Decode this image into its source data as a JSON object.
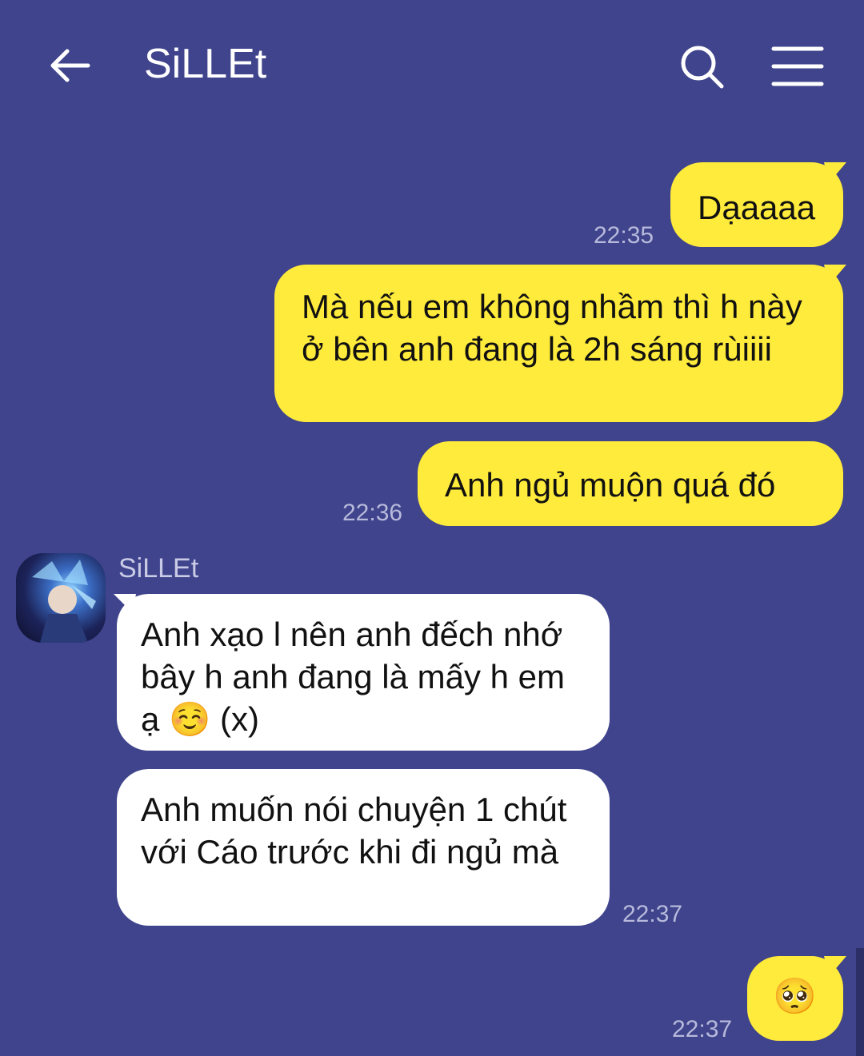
{
  "header": {
    "title": "SiLLEt",
    "back_icon": "arrow-left-icon",
    "search_icon": "search-icon",
    "menu_icon": "hamburger-menu-icon"
  },
  "colors": {
    "background": "#3f448c",
    "my_bubble": "#ffeb3b",
    "their_bubble": "#ffffff",
    "timestamp": "#b7badb"
  },
  "messages": [
    {
      "from": "me",
      "text": "Dạaaaa",
      "time": "22:35"
    },
    {
      "from": "me",
      "text": "Mà nếu em không nhầm thì h này ở bên anh đang là 2h sáng rùiiii",
      "time": ""
    },
    {
      "from": "me",
      "text": "Anh ngủ muộn quá đó",
      "time": "22:36"
    },
    {
      "from": "them",
      "sender": "SiLLEt",
      "text_main": "Anh xạo l nên anh đếch nhớ bây h anh đang là mấy h em ạ",
      "emoji": "☺️",
      "text_tail": "(x)",
      "time": ""
    },
    {
      "from": "them",
      "text": "Anh muốn nói chuyện 1 chút với Cáo trước khi đi ngủ mà",
      "time": "22:37"
    },
    {
      "from": "me",
      "emoji": "🥺",
      "time": "22:37"
    }
  ]
}
